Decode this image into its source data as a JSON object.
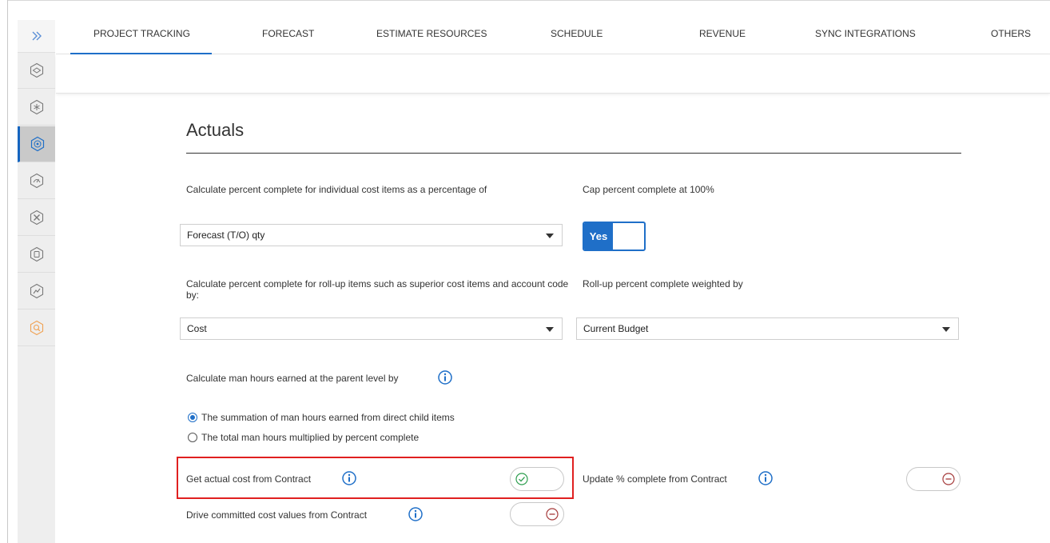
{
  "nav": {
    "expand_icon": "double-chevron-right-icon",
    "rail_icons": [
      "cube-icon",
      "network-icon",
      "target-icon",
      "gauge-icon",
      "tools-icon",
      "shield-icon",
      "chart-icon",
      "search-icon"
    ],
    "accent": "#1f6fc8"
  },
  "tabs": [
    {
      "label": "PROJECT TRACKING",
      "active": true
    },
    {
      "label": "FORECAST"
    },
    {
      "label": "ESTIMATE RESOURCES"
    },
    {
      "label": "SCHEDULE"
    },
    {
      "label": "REVENUE"
    },
    {
      "label": "SYNC INTEGRATIONS"
    },
    {
      "label": "OTHERS"
    }
  ],
  "section": {
    "title": "Actuals"
  },
  "percent_complete": {
    "label": "Calculate percent complete for individual cost items as a percentage of",
    "value": "Forecast (T/O) qty"
  },
  "cap_percent": {
    "label": "Cap percent complete at 100%",
    "toggle_label": "Yes",
    "on": true
  },
  "rollup": {
    "label": "Calculate percent complete for roll-up items such as superior cost items and account code by:",
    "value": "Cost"
  },
  "rollup_weighted": {
    "label": "Roll-up percent complete weighted by",
    "value": "Current Budget"
  },
  "man_hours": {
    "label": "Calculate man hours earned at the parent level by",
    "options": [
      {
        "label": "The summation of man hours earned from direct child items",
        "selected": true
      },
      {
        "label": "The total man hours multiplied by percent complete",
        "selected": false
      }
    ]
  },
  "contract": {
    "actual_cost_label": "Get actual cost from Contract",
    "actual_cost_on": true,
    "update_percent_label": "Update % complete from Contract",
    "update_percent_on": false,
    "committed_cost_label": "Drive committed cost values from Contract",
    "committed_cost_on": false
  },
  "colors": {
    "highlight": "#e02020",
    "check": "#2e9e4f",
    "minus": "#a63b3b"
  }
}
